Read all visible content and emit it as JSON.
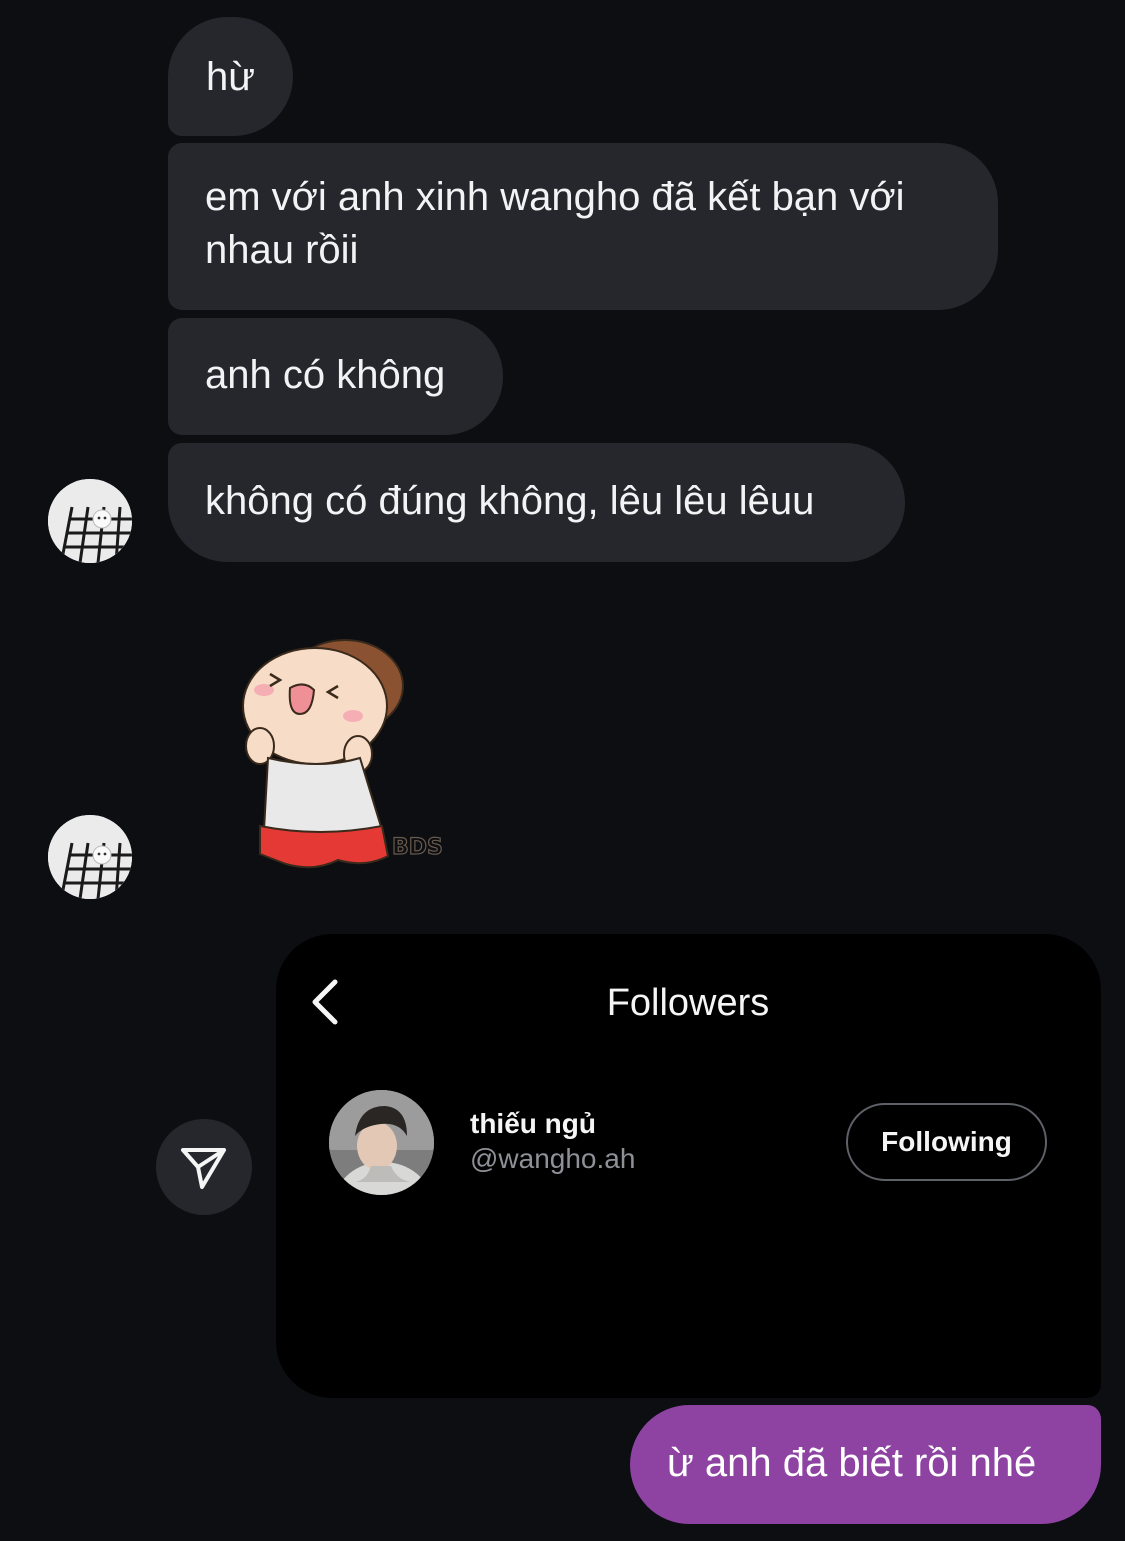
{
  "messages": [
    {
      "sender": "them",
      "text": "hừ"
    },
    {
      "sender": "them",
      "text": "em với anh xinh wangho đã kết bạn với nhau rồii"
    },
    {
      "sender": "them",
      "text": "anh có không"
    },
    {
      "sender": "them",
      "text": "không có đúng không, lêu lêu lêuu"
    },
    {
      "sender": "me",
      "text": "ừ anh đã biết rồi nhé"
    }
  ],
  "sticker": {
    "icon": "tongue-out-boy-sticker",
    "caption": "BDS"
  },
  "shared_post": {
    "title": "Followers",
    "back_icon": "chevron-left-icon",
    "user": {
      "name": "thiếu ngủ",
      "handle": "@wangho.ah",
      "follow_label": "Following"
    }
  },
  "share_icon": "send-icon",
  "colors": {
    "background": "#0c0e12",
    "incoming_bubble": "#25272c",
    "outgoing_bubble": "#8e43a3",
    "card_background": "#000000",
    "secondary_text": "#8e9097"
  }
}
